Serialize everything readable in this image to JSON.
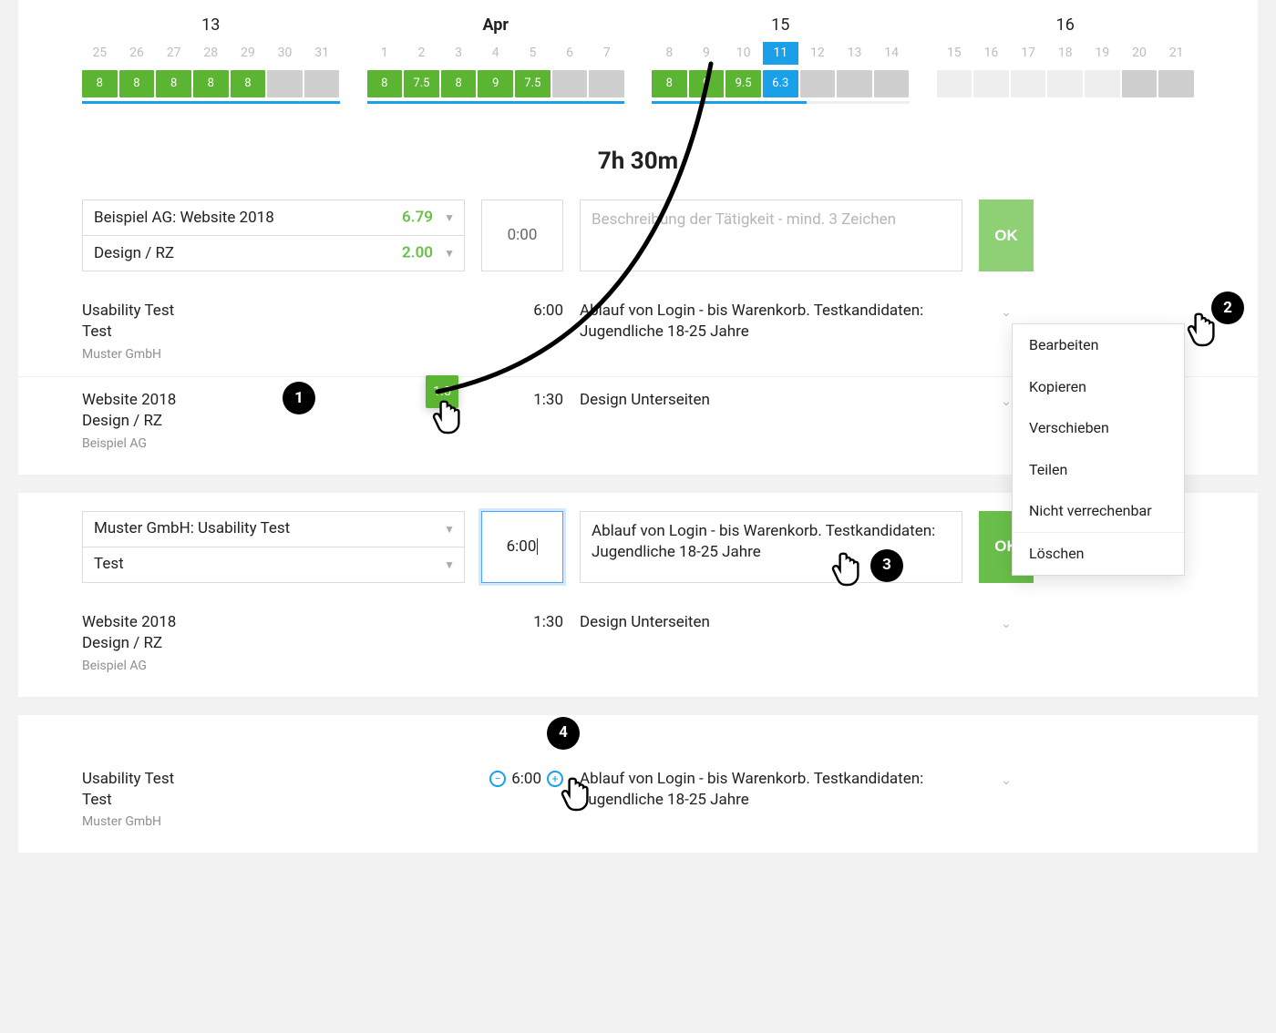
{
  "calendar": {
    "weeks": [
      {
        "label": "13",
        "bold": false,
        "days": [
          "25",
          "26",
          "27",
          "28",
          "29",
          "30",
          "31"
        ],
        "hours": [
          {
            "v": "8",
            "c": "green"
          },
          {
            "v": "8",
            "c": "green"
          },
          {
            "v": "8",
            "c": "green"
          },
          {
            "v": "8",
            "c": "green"
          },
          {
            "v": "8",
            "c": "green"
          },
          {
            "v": "",
            "c": "gray"
          },
          {
            "v": "",
            "c": "gray"
          }
        ],
        "underline": "full"
      },
      {
        "label": "Apr",
        "bold": true,
        "days": [
          "1",
          "2",
          "3",
          "4",
          "5",
          "6",
          "7"
        ],
        "hours": [
          {
            "v": "8",
            "c": "green"
          },
          {
            "v": "7.5",
            "c": "green"
          },
          {
            "v": "8",
            "c": "green"
          },
          {
            "v": "9",
            "c": "green"
          },
          {
            "v": "7.5",
            "c": "green"
          },
          {
            "v": "",
            "c": "gray"
          },
          {
            "v": "",
            "c": "gray"
          }
        ],
        "underline": "full"
      },
      {
        "label": "15",
        "bold": false,
        "days": [
          "8",
          "9",
          "10",
          "11",
          "12",
          "13",
          "14"
        ],
        "selected_index": 3,
        "hours": [
          {
            "v": "8",
            "c": "green"
          },
          {
            "v": "9",
            "c": "green"
          },
          {
            "v": "9.5",
            "c": "green"
          },
          {
            "v": "6.3",
            "c": "blue"
          },
          {
            "v": "",
            "c": "gray"
          },
          {
            "v": "",
            "c": "gray"
          },
          {
            "v": "",
            "c": "gray"
          }
        ],
        "underline": "partial"
      },
      {
        "label": "16",
        "bold": false,
        "days": [
          "15",
          "16",
          "17",
          "18",
          "19",
          "20",
          "21"
        ],
        "hours": [
          {
            "v": "",
            "c": "light"
          },
          {
            "v": "",
            "c": "light"
          },
          {
            "v": "",
            "c": "light"
          },
          {
            "v": "",
            "c": "light"
          },
          {
            "v": "",
            "c": "light"
          },
          {
            "v": "",
            "c": "gray"
          },
          {
            "v": "",
            "c": "gray"
          }
        ],
        "underline": "none"
      }
    ]
  },
  "summary": {
    "duration": "7h 30m"
  },
  "edit1": {
    "project": "Beispiel AG: Website 2018",
    "project_hours": "6.79",
    "activity": "Design / RZ",
    "activity_hours": "2.00",
    "time": "0:00",
    "placeholder": "Beschreibung der Tätigkeit - mind. 3 Zeichen",
    "ok": "OK"
  },
  "entries1": [
    {
      "title": "Usability Test",
      "sub": "Test",
      "client": "Muster GmbH",
      "time": "6:00",
      "desc": "Ablauf von Login - bis Warenkorb. Testkandidaten: Jugendliche 18-25 Jahre"
    },
    {
      "title": "Website 2018",
      "sub": "Design / RZ",
      "client": "Beispiel AG",
      "time": "1:30",
      "desc": "Design Unterseiten"
    }
  ],
  "drag_badge": "1.5",
  "context_menu": {
    "items": [
      "Bearbeiten",
      "Kopieren",
      "Verschieben",
      "Teilen",
      "Nicht verrechenbar"
    ],
    "delete": "Löschen"
  },
  "edit2": {
    "project": "Muster GmbH: Usability Test",
    "activity": "Test",
    "time": "6:00",
    "desc": "Ablauf von Login - bis Warenkorb. Testkandidaten: Jugendliche 18-25 Jahre",
    "ok": "OK"
  },
  "entries2": [
    {
      "title": "Website 2018",
      "sub": "Design / RZ",
      "client": "Beispiel AG",
      "time": "1:30",
      "desc": "Design Unterseiten"
    }
  ],
  "entries3": [
    {
      "title": "Usability Test",
      "sub": "Test",
      "client": "Muster GmbH",
      "time": "6:00",
      "desc": "Ablauf von Login - bis Warenkorb. Testkandidaten: Jugendliche 18-25 Jahre"
    }
  ],
  "callouts": {
    "one": "1",
    "two": "2",
    "three": "3",
    "four": "4"
  }
}
